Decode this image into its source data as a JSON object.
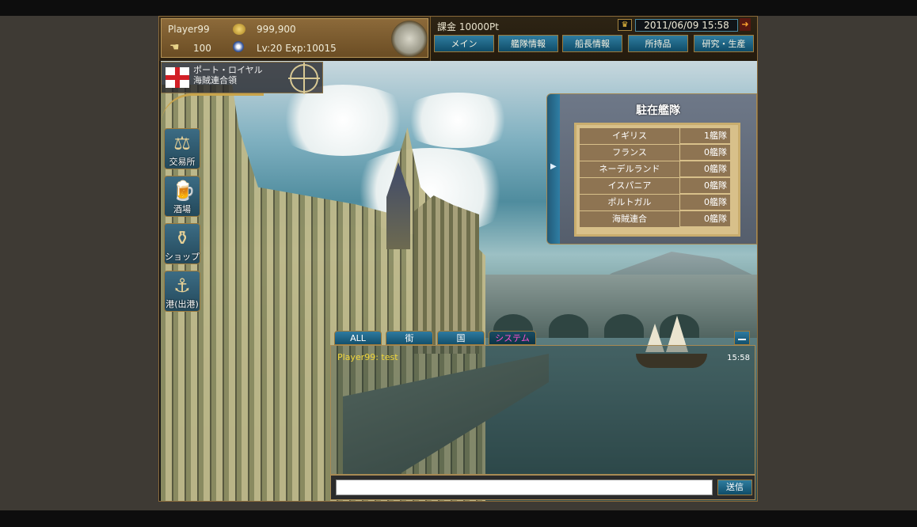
{
  "player": {
    "name": "Player99",
    "gold": "999,900",
    "hand_count": "100",
    "level_exp": "Lv:20 Exp:10015"
  },
  "header": {
    "charge": "課金 10000Pt",
    "datetime": "2011/06/09 15:58"
  },
  "nav": [
    "メイン",
    "艦隊情報",
    "船長情報",
    "所持品",
    "研究・生産"
  ],
  "location": {
    "name": "ポート・ロイヤル",
    "affiliation": "海賊連合領"
  },
  "side_buttons": [
    "交易所",
    "酒場",
    "ショップ",
    "港(出港)"
  ],
  "fleet": {
    "title": "駐在艦隊",
    "rows": [
      {
        "nation": "イギリス",
        "count": "1艦隊"
      },
      {
        "nation": "フランス",
        "count": "0艦隊"
      },
      {
        "nation": "ネーデルランド",
        "count": "0艦隊"
      },
      {
        "nation": "イスパニア",
        "count": "0艦隊"
      },
      {
        "nation": "ポルトガル",
        "count": "0艦隊"
      },
      {
        "nation": "海賊連合",
        "count": "0艦隊"
      }
    ]
  },
  "chat": {
    "tabs": [
      "ALL",
      "街",
      "国",
      "システム"
    ],
    "selected_tab": "システム",
    "message": "Player99: test",
    "time": "15:58",
    "send_label": "送信",
    "input_value": ""
  }
}
